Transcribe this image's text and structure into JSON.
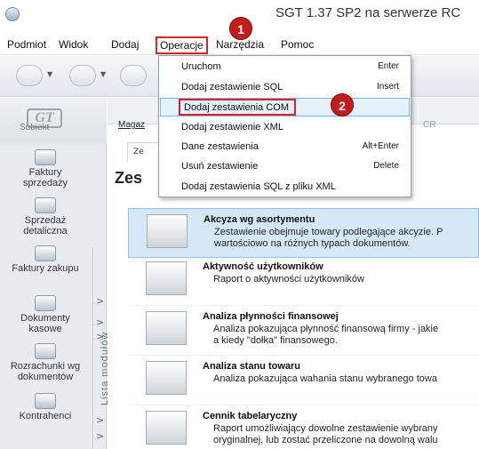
{
  "window": {
    "title": "SGT 1.37 SP2 na serwerze RC"
  },
  "menubar": {
    "items": [
      {
        "label": "Podmiot"
      },
      {
        "label": "Widok"
      },
      {
        "label": "Dodaj"
      },
      {
        "label": "Operacje",
        "active": true
      },
      {
        "label": "Narzędzia"
      },
      {
        "label": "Pomoc"
      }
    ]
  },
  "annotations": {
    "step1": "1",
    "step2": "2",
    "highlight_color": "#d8232a"
  },
  "operacje_menu": {
    "items": [
      {
        "label": "Uruchom",
        "shortcut": "Enter"
      },
      {
        "label": "Dodaj zestawienie SQL",
        "shortcut": "Insert"
      },
      {
        "label": "Dodaj zestawienia COM",
        "shortcut": "",
        "highlighted": true
      },
      {
        "label": "Dodaj zestawienie XML",
        "shortcut": ""
      },
      {
        "label": "Dane zestawienia",
        "shortcut": "Alt+Enter"
      },
      {
        "label": "Usuń zestawienie",
        "shortcut": "Delete"
      },
      {
        "label": "Dodaj zestawienia SQL z pliku XML",
        "shortcut": ""
      }
    ]
  },
  "sidebar": {
    "logo_sub": "Subiekt",
    "items": [
      {
        "label_line1": "Faktury",
        "label_line2": "sprzedaży"
      },
      {
        "label_line1": "Sprzedaż",
        "label_line2": "detaliczna"
      },
      {
        "label_line1": "Faktury zakupu",
        "label_line2": ""
      },
      {
        "label_line1": "Dokumenty",
        "label_line2": "kasowe"
      },
      {
        "label_line1": "Rozrachunki wg",
        "label_line2": "dokumentów"
      },
      {
        "label_line1": "Kontrahenci",
        "label_line2": ""
      }
    ],
    "vertical_label": "Lista modułów"
  },
  "content": {
    "tab_link": "Magaz",
    "tab_ext": "CR",
    "subtab": "Ze",
    "section_title": "Zes",
    "reports": [
      {
        "title": "Akcyza wg asortymentu",
        "desc1": "Zestawienie obejmuje towary podlegające akcyzie. P",
        "desc2": "wartościowo na różnych typach dokumentów.",
        "selected": true
      },
      {
        "title": "Aktywność użytkowników",
        "desc1": "Raport o aktywności użytkowników",
        "desc2": ""
      },
      {
        "title": "Analiza płynności finansowej",
        "desc1": "Analiza pokazująca płynność finansową firmy - jakie",
        "desc2": "a kiedy \"dołka\" finansowego."
      },
      {
        "title": "Analiza stanu towaru",
        "desc1": "Analiza pokazująca wahania stanu wybranego towa",
        "desc2": ""
      },
      {
        "title": "Cennik tabelaryczny",
        "desc1": "Raport umożliwiający dowolne zestawienie wybrany",
        "desc2": "oryginalnej, lub zostać przeliczone na dowolną walu"
      }
    ]
  }
}
